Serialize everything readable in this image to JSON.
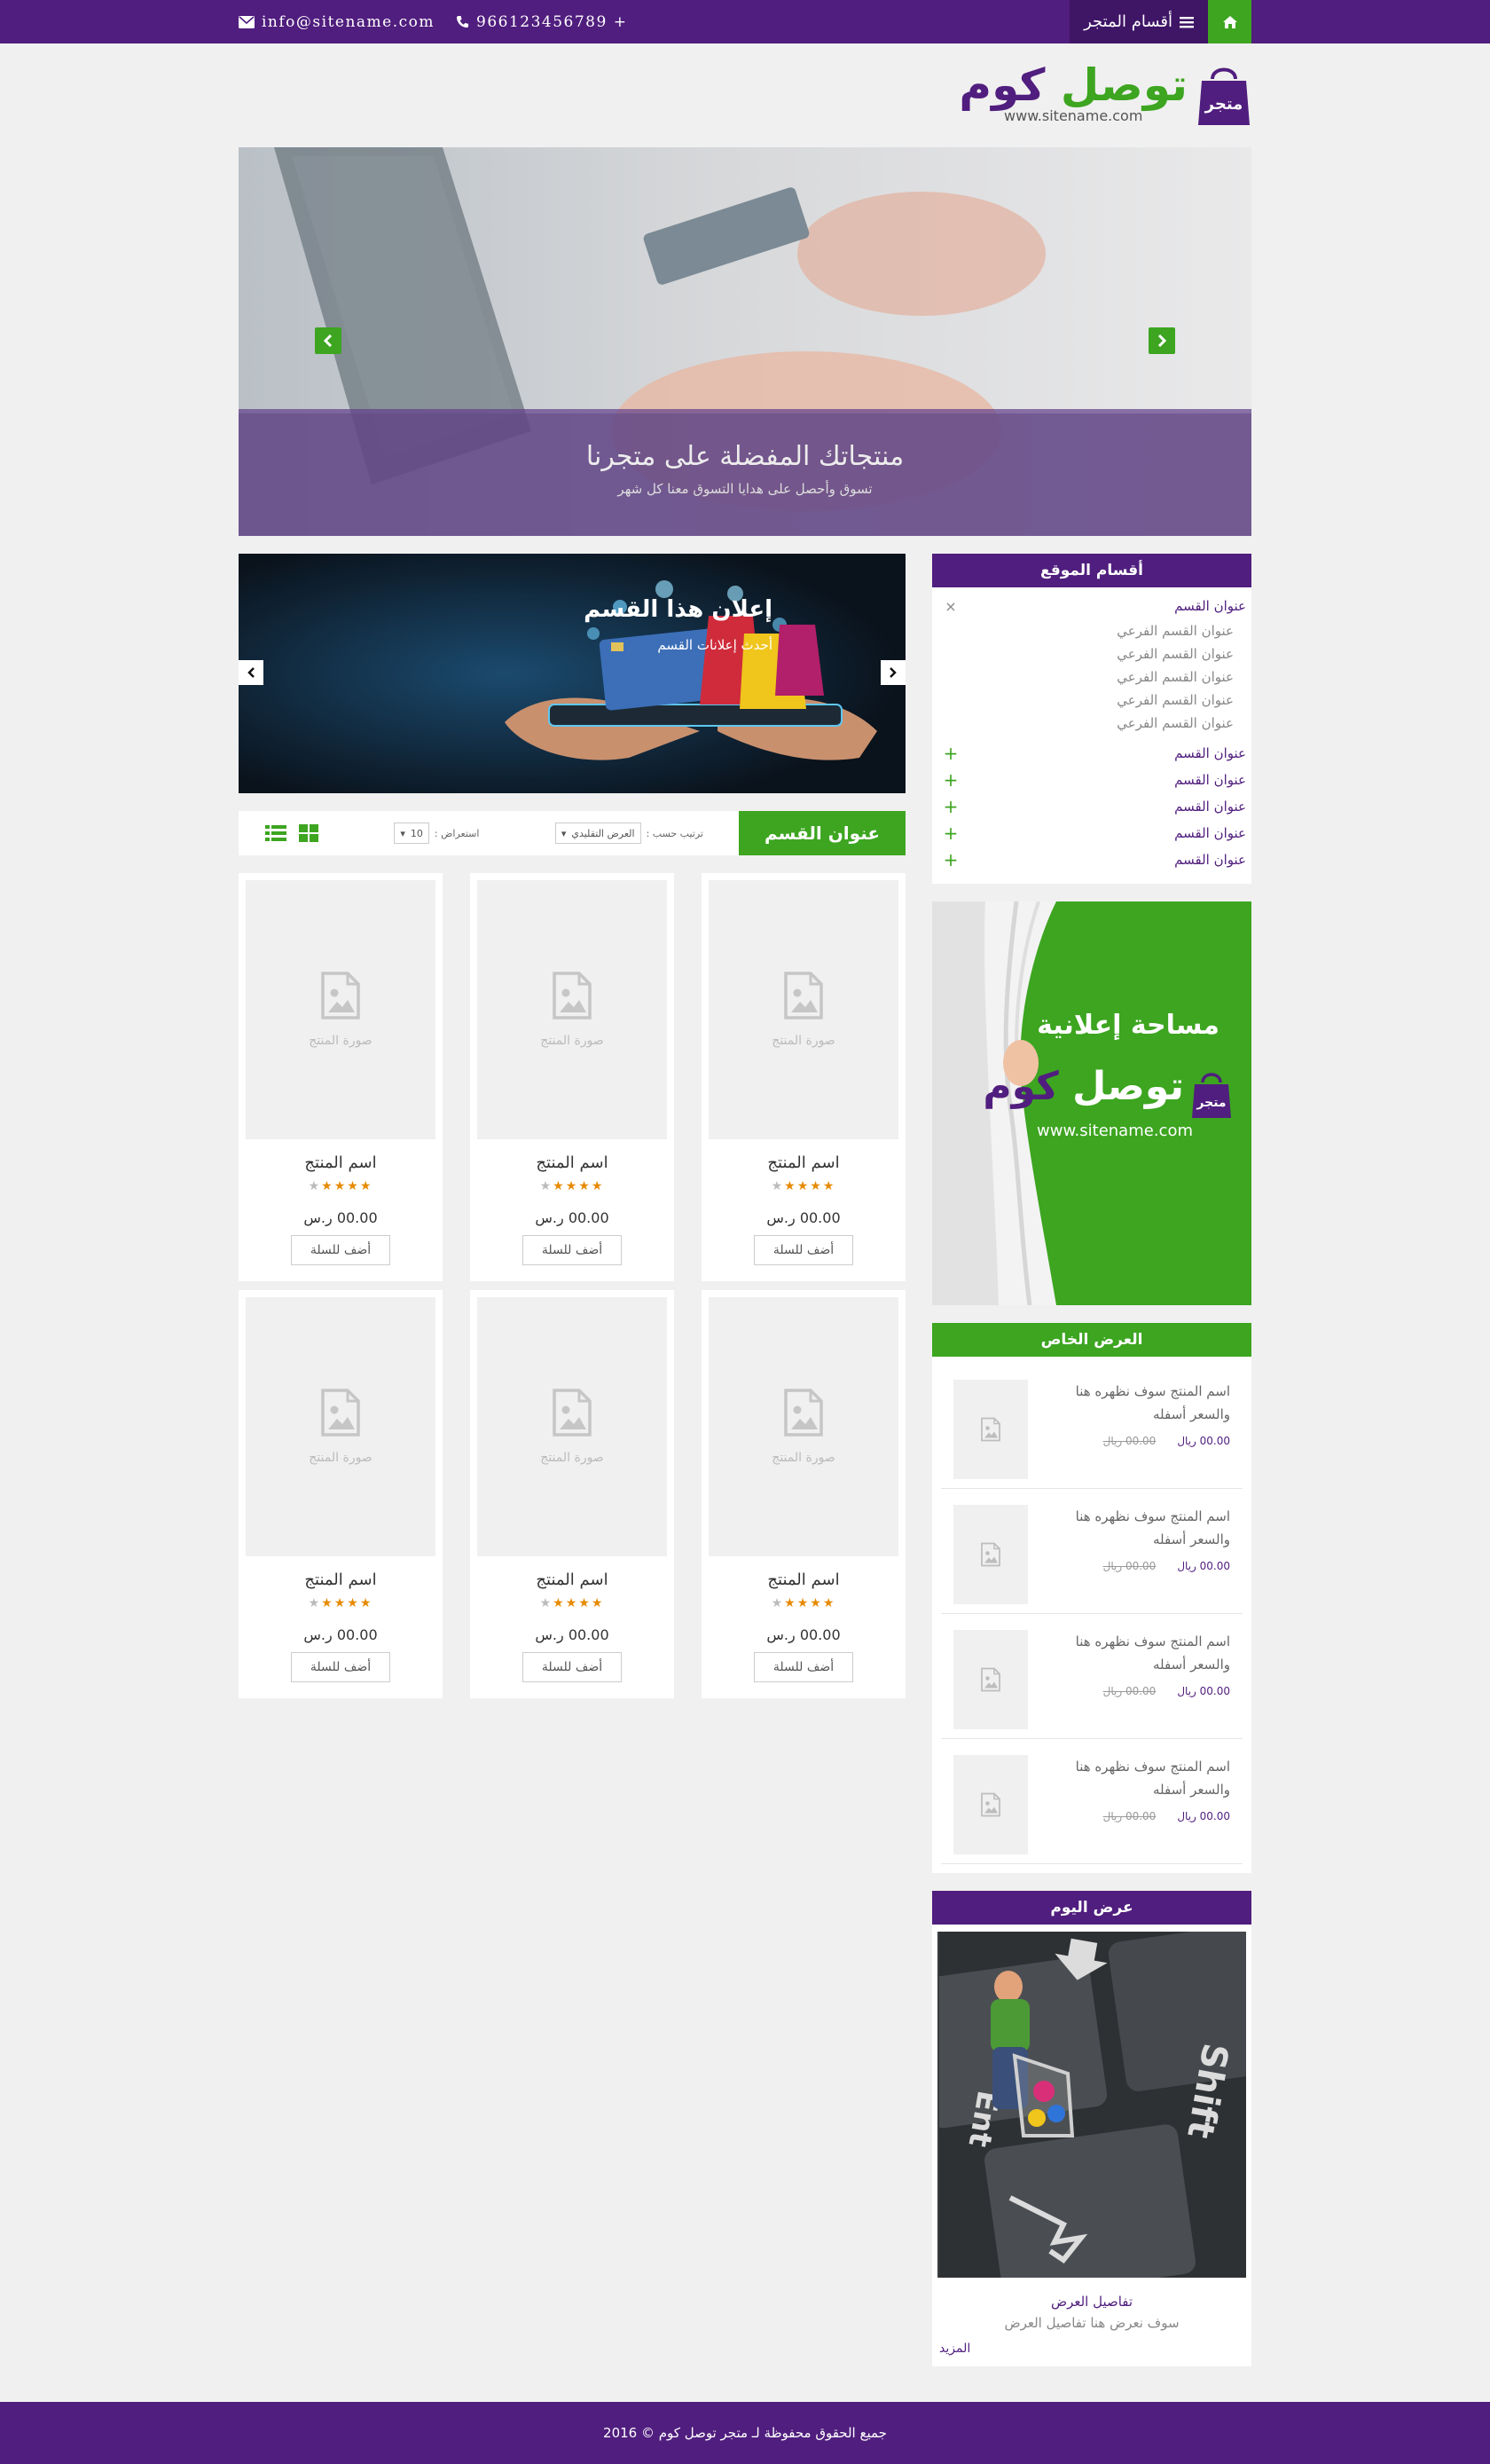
{
  "topbar": {
    "email": "info@sitename.com",
    "phone": "966123456789 +",
    "categories_label": "أقسام المتجر"
  },
  "logo": {
    "bag_label": "متجر",
    "part1": "توصل",
    "part2": "كوم",
    "url": "www.sitename.com"
  },
  "hero": {
    "title": "منتجاتك المفضلة على متجرنا",
    "subtitle": "تسوق وأحصل على هدايا التسوق معنا كل شهر"
  },
  "sidebar": {
    "categories_title": "أقسام الموقع",
    "categories": [
      {
        "label": "عنوان القسم",
        "expanded": true,
        "subs": [
          "عنوان القسم الفرعي",
          "عنوان القسم الفرعي",
          "عنوان القسم الفرعي",
          "عنوان القسم الفرعي",
          "عنوان القسم الفرعي"
        ]
      },
      {
        "label": "عنوان القسم"
      },
      {
        "label": "عنوان القسم"
      },
      {
        "label": "عنوان القسم"
      },
      {
        "label": "عنوان القسم"
      },
      {
        "label": "عنوان القسم"
      }
    ],
    "ad": {
      "text": "مساحة إعلانية",
      "bag_label": "متجر",
      "part1": "توصل",
      "part2": "كوم",
      "url": "www.sitename.com"
    },
    "special_title": "العرض الخاص",
    "offers": [
      {
        "name": "اسم المنتج سوف نظهره هنا والسعر أسفله",
        "new_price": "00.00 ريال",
        "old_price": "00.00 ريال"
      },
      {
        "name": "اسم المنتج سوف نظهره هنا والسعر أسفله",
        "new_price": "00.00 ريال",
        "old_price": "00.00 ريال"
      },
      {
        "name": "اسم المنتج سوف نظهره هنا والسعر أسفله",
        "new_price": "00.00 ريال",
        "old_price": "00.00 ريال"
      },
      {
        "name": "اسم المنتج سوف نظهره هنا والسعر أسفله",
        "new_price": "00.00 ريال",
        "old_price": "00.00 ريال"
      }
    ],
    "daily_title": "عرض اليوم",
    "daily": {
      "title": "تفاصيل العرض",
      "desc": "سوف نعرض هنا تفاصيل العرض",
      "more": "المزيد"
    }
  },
  "section_ad": {
    "title": "إعلان هذا القسم",
    "subtitle": "أحدث إعلانات القسم"
  },
  "toolbar": {
    "section_title": "عنوان القسم",
    "sort_label": "ترتيب حسب :",
    "sort_value": "العرض التقليدي",
    "show_label": "استعراض :",
    "show_value": "10"
  },
  "products": [
    {
      "image_caption": "صورة المنتج",
      "name": "اسم المنتج",
      "rating": 4,
      "price": "00.00 ر.س",
      "button": "أضف للسلة"
    },
    {
      "image_caption": "صورة المنتج",
      "name": "اسم المنتج",
      "rating": 4,
      "price": "00.00 ر.س",
      "button": "أضف للسلة"
    },
    {
      "image_caption": "صورة المنتج",
      "name": "اسم المنتج",
      "rating": 4,
      "price": "00.00 ر.س",
      "button": "أضف للسلة"
    },
    {
      "image_caption": "صورة المنتج",
      "name": "اسم المنتج",
      "rating": 4,
      "price": "00.00 ر.س",
      "button": "أضف للسلة"
    },
    {
      "image_caption": "صورة المنتج",
      "name": "اسم المنتج",
      "rating": 4,
      "price": "00.00 ر.س",
      "button": "أضف للسلة"
    },
    {
      "image_caption": "صورة المنتج",
      "name": "اسم المنتج",
      "rating": 4,
      "price": "00.00 ر.س",
      "button": "أضف للسلة"
    }
  ],
  "footer": {
    "copyright": "جميع الحقوق محفوظة لـ متجر توصل كوم © 2016"
  },
  "colors": {
    "purple": "#501e7e",
    "green": "#3da520",
    "star": "#e68a00"
  },
  "icons": [
    "home-icon",
    "bars-icon",
    "envelope-icon",
    "phone-icon",
    "shopping-bag-icon",
    "chevron-left-icon",
    "chevron-right-icon",
    "plus-icon",
    "close-icon",
    "image-placeholder-icon",
    "list-view-icon",
    "grid-view-icon",
    "star-icon"
  ]
}
